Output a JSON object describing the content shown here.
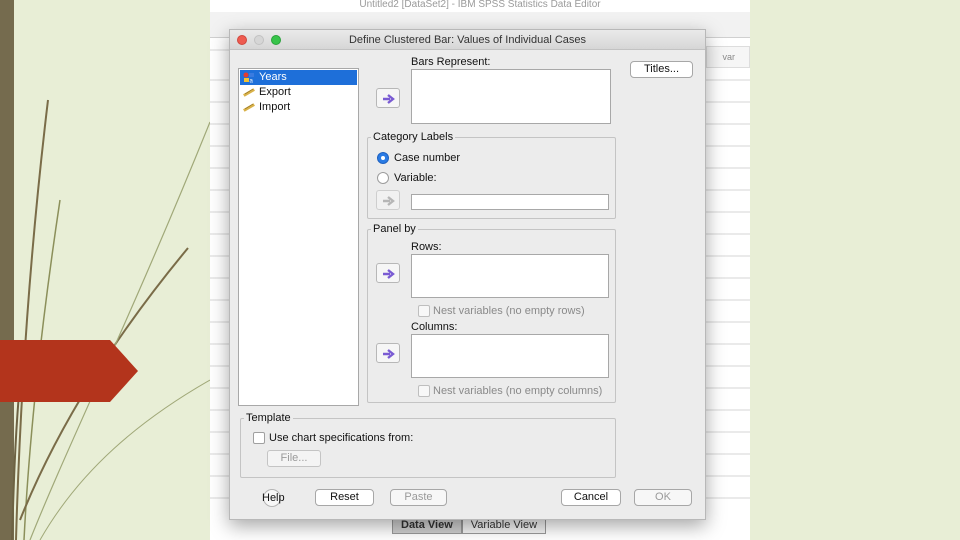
{
  "background_window": {
    "title": "Untitled2 [DataSet2] - IBM SPSS Statistics Data Editor",
    "column_header": "var",
    "tabs": [
      {
        "label": "Data View",
        "active": true
      },
      {
        "label": "Variable View",
        "active": false
      }
    ]
  },
  "dialog": {
    "title": "Define Clustered Bar: Values of Individual Cases",
    "variables": [
      {
        "label": "Years",
        "icon": "nominal-variable-icon",
        "selected": true
      },
      {
        "label": "Export",
        "icon": "scale-variable-icon",
        "selected": false
      },
      {
        "label": "Import",
        "icon": "scale-variable-icon",
        "selected": false
      }
    ],
    "bars_represent_label": "Bars Represent:",
    "titles_button": "Titles...",
    "category_labels": {
      "group_title": "Category Labels",
      "option_case_number": "Case number",
      "option_variable": "Variable:",
      "selected": "Case number"
    },
    "panel_by": {
      "group_title": "Panel by",
      "rows_label": "Rows:",
      "nest_rows_label": "Nest variables (no empty rows)",
      "columns_label": "Columns:",
      "nest_columns_label": "Nest variables (no empty columns)"
    },
    "template": {
      "group_title": "Template",
      "use_spec_label": "Use chart specifications from:",
      "file_button": "File..."
    },
    "buttons": {
      "help": "Help",
      "reset": "Reset",
      "paste": "Paste",
      "cancel": "Cancel",
      "ok": "OK"
    }
  },
  "colors": {
    "slide_background": "#e8eed6",
    "accent_red": "#b3341c",
    "selection_blue": "#1e6fd9",
    "arrow_purple": "#7a5bd3"
  }
}
